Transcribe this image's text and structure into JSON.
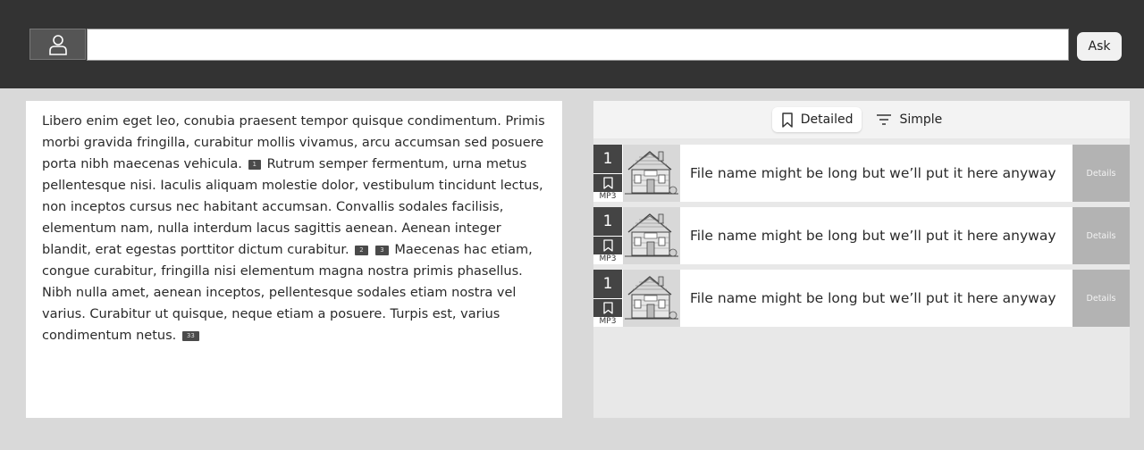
{
  "header": {
    "avatar_icon": "user-icon",
    "search": {
      "value": "",
      "placeholder": ""
    },
    "ask_label": "Ask"
  },
  "content": {
    "segments": [
      "Libero enim eget leo, conubia praesent tempor quisque condimentum. Primis morbi gravida fringilla, curabitur mollis vivamus, arcu accumsan sed posuere porta nibh maecenas vehicula.",
      "Rutrum semper fermentum, urna metus pellentesque nisi. Iaculis aliquam molestie dolor, vestibulum tincidunt lectus, non inceptos cursus nec habitant accumsan. Convallis sodales facilisis, elementum nam, nulla interdum lacus sagittis aenean. Aenean integer blandit, erat egestas porttitor dictum curabitur.",
      "Maecenas hac etiam, congue curabitur, fringilla nisi elementum magna nostra primis phasellus. Nibh nulla amet, aenean inceptos, pellentesque sodales etiam nostra vel varius. Curabitur ut quisque, neque etiam a posuere. Turpis est, varius condimentum netus."
    ],
    "citations": [
      "1",
      "2",
      "3",
      "33"
    ]
  },
  "view_toggle": {
    "detailed_label": "Detailed",
    "simple_label": "Simple",
    "active": "detailed"
  },
  "files": [
    {
      "number": "1",
      "format": "MP3",
      "name": "File name might be long but we’ll put it here anyway",
      "details_label": "Details"
    },
    {
      "number": "1",
      "format": "MP3",
      "name": "File name might be long but we’ll put it here anyway",
      "details_label": "Details"
    },
    {
      "number": "1",
      "format": "MP3",
      "name": "File name might be long but we’ll put it here anyway",
      "details_label": "Details"
    }
  ],
  "colors": {
    "topbar": "#333333",
    "page_bg": "#d9d9d9",
    "details_bg": "#b3b3b3"
  }
}
